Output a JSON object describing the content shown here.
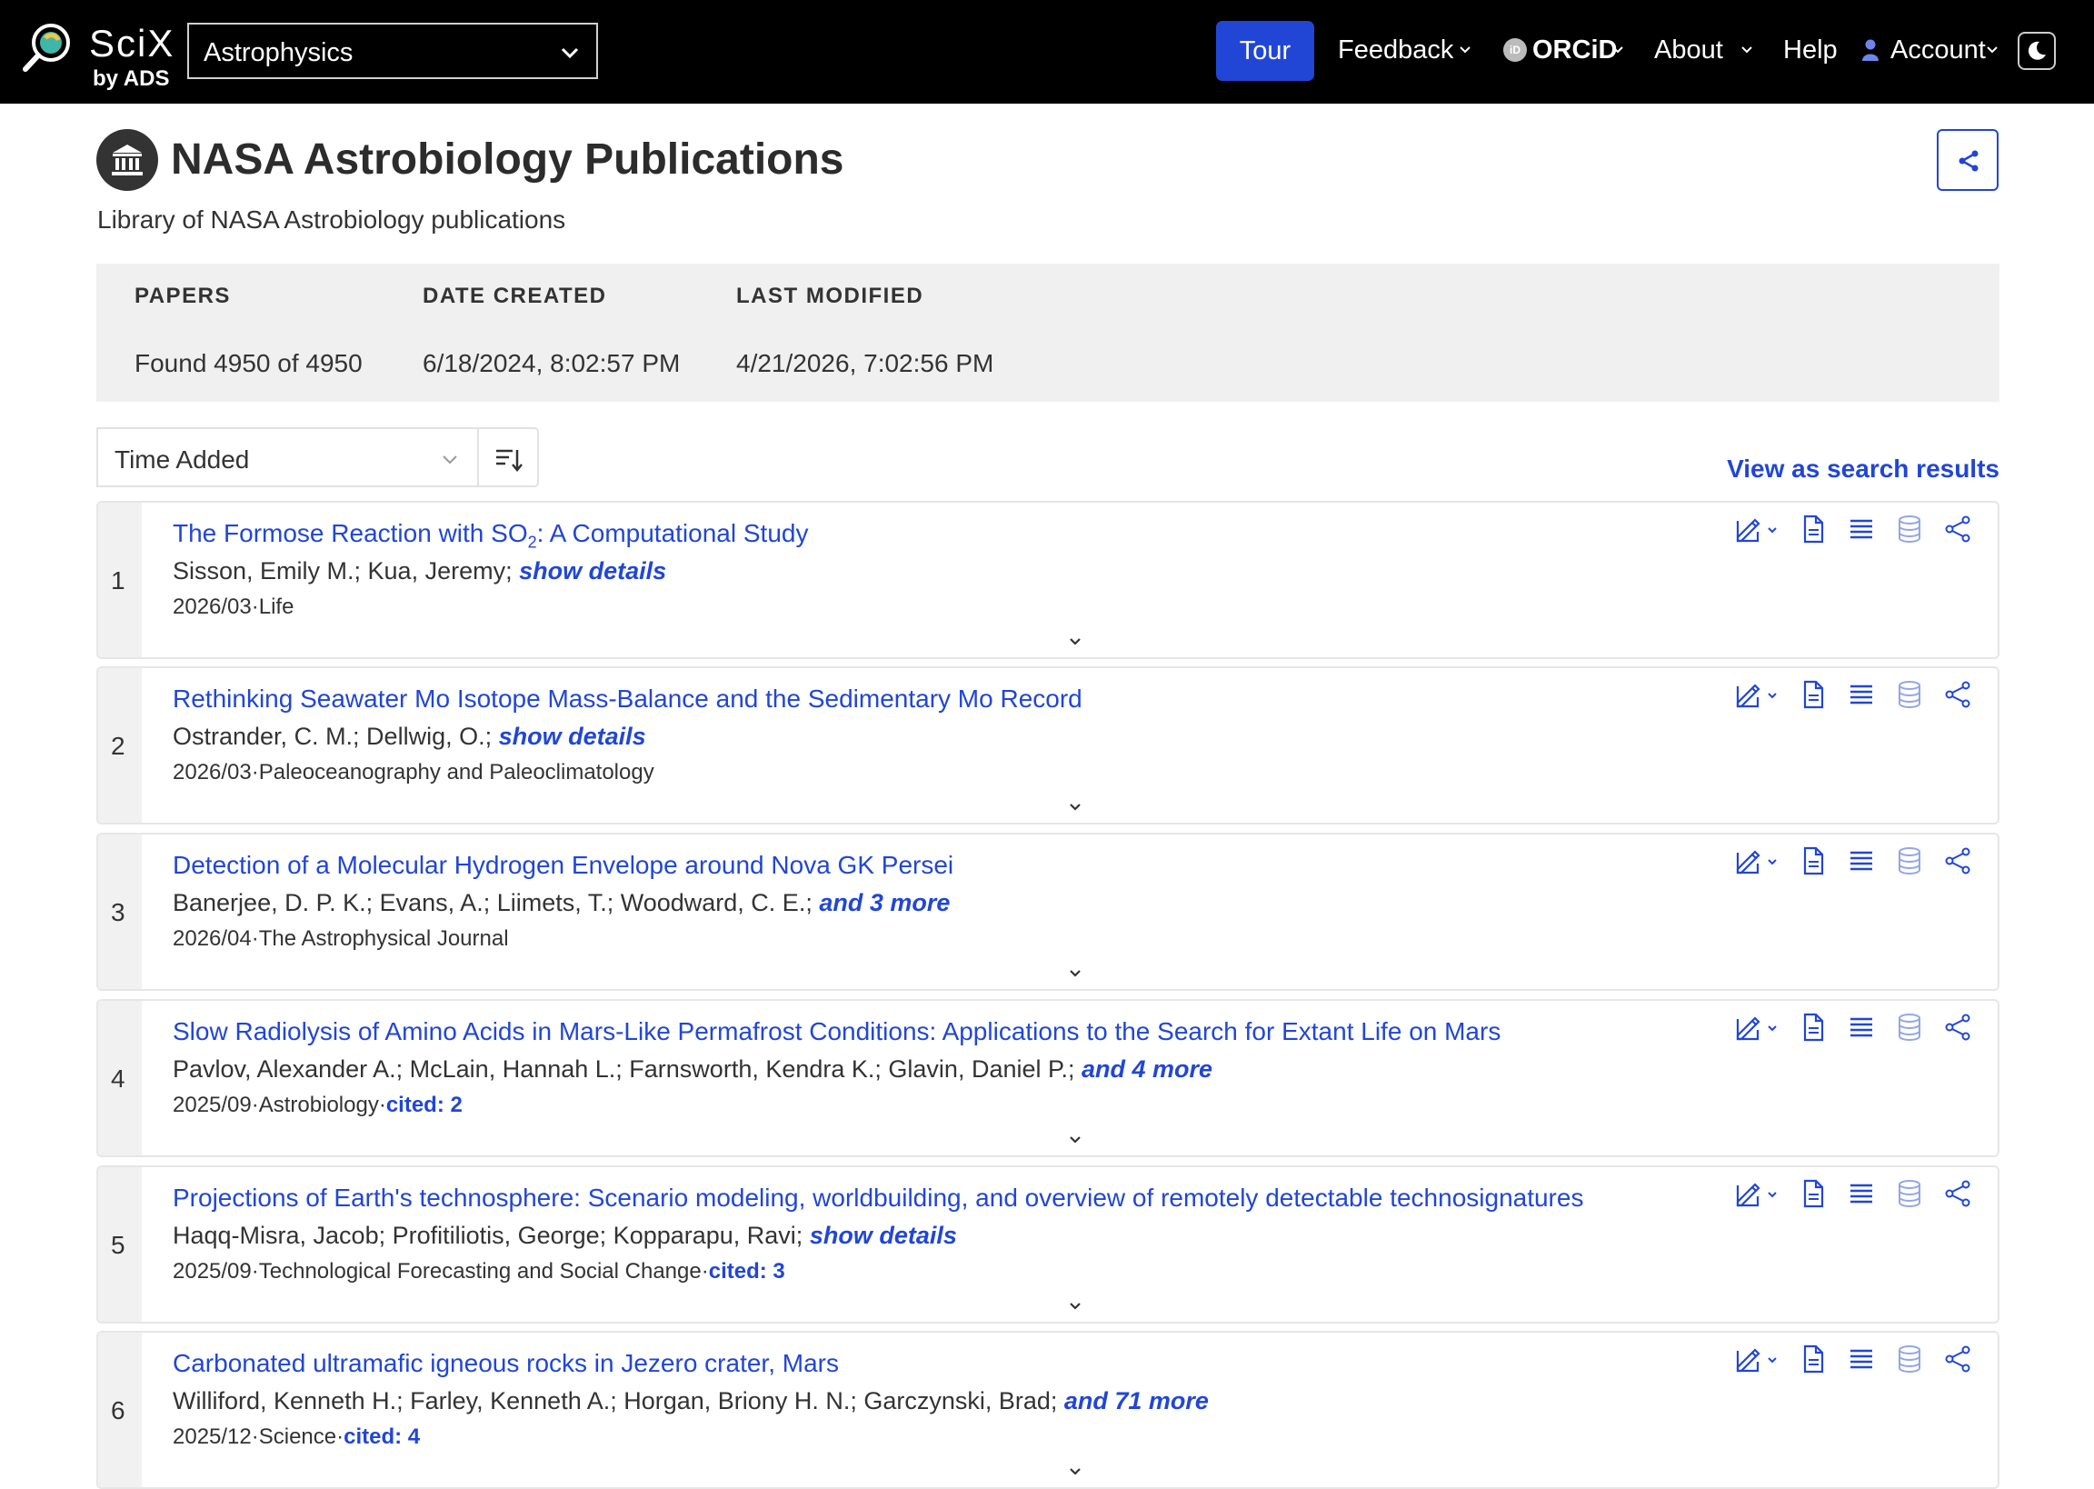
{
  "header": {
    "logo_text": "SciX",
    "logo_sub": "by ADS",
    "discipline": "Astrophysics",
    "nav": {
      "tour": "Tour",
      "feedback": "Feedback",
      "orcid": "ORCiD",
      "about": "About",
      "help": "Help",
      "account": "Account"
    },
    "colors": {
      "bar": "#000000",
      "tour_button": "#2146d6"
    }
  },
  "library": {
    "title": "NASA Astrobiology Publications",
    "description": "Library of NASA Astrobiology publications",
    "stats": {
      "papers_label": "PAPERS",
      "papers_value": "Found 4950 of 4950",
      "created_label": "DATE CREATED",
      "created_value": "6/18/2024, 8:02:57 PM",
      "modified_label": "LAST MODIFIED",
      "modified_value": "4/21/2026, 7:02:56 PM"
    }
  },
  "controls": {
    "sort_by": "Time Added",
    "view_as_search": "View as search results"
  },
  "results": [
    {
      "index": "1",
      "title_pre": "The Formose Reaction with SO",
      "title_sub": "2",
      "title_post": ": A Computational Study",
      "authors": "Sisson, Emily M.; Kua, Jeremy; ",
      "more": "show details",
      "meta": "2026/03·Life",
      "cited": ""
    },
    {
      "index": "2",
      "title_pre": "Rethinking Seawater Mo Isotope Mass-Balance and the Sedimentary Mo Record",
      "title_sub": "",
      "title_post": "",
      "authors": "Ostrander, C. M.; Dellwig, O.; ",
      "more": "show details",
      "meta": "2026/03·Paleoceanography and Paleoclimatology",
      "cited": ""
    },
    {
      "index": "3",
      "title_pre": "Detection of a Molecular Hydrogen Envelope around Nova GK Persei",
      "title_sub": "",
      "title_post": "",
      "authors": "Banerjee, D. P. K.; Evans, A.; Liimets, T.; Woodward, C. E.; ",
      "more": "and 3 more",
      "meta": "2026/04·The Astrophysical Journal",
      "cited": ""
    },
    {
      "index": "4",
      "title_pre": "Slow Radiolysis of Amino Acids in Mars-Like Permafrost Conditions: Applications to the Search for Extant Life on Mars",
      "title_sub": "",
      "title_post": "",
      "authors": "Pavlov, Alexander A.; McLain, Hannah L.; Farnsworth, Kendra K.; Glavin, Daniel P.; ",
      "more": "and 4 more",
      "meta": "2025/09·Astrobiology·",
      "cited": "cited: 2"
    },
    {
      "index": "5",
      "title_pre": "Projections of Earth's technosphere: Scenario modeling, worldbuilding, and overview of remotely detectable technosignatures",
      "title_sub": "",
      "title_post": "",
      "authors": "Haqq-Misra, Jacob; Profitiliotis, George; Kopparapu, Ravi; ",
      "more": "show details",
      "meta": "2025/09·Technological Forecasting and Social Change·",
      "cited": "cited: 3"
    },
    {
      "index": "6",
      "title_pre": "Carbonated ultramafic igneous rocks in Jezero crater, Mars",
      "title_sub": "",
      "title_post": "",
      "authors": "Williford, Kenneth H.; Farley, Kenneth A.; Horgan, Briony H. N.; Garczynski, Brad; ",
      "more": "and 71 more",
      "meta": "2025/12·Science·",
      "cited": "cited: 4"
    }
  ],
  "icons": {
    "logo": "scix-logo-icon",
    "discipline_chevron": "chevron-down-icon",
    "account": "user-icon",
    "theme": "moon-icon",
    "library": "institution-icon",
    "share": "share-icon",
    "sort_direction": "sort-descending-icon",
    "row_actions": [
      "edit-icon",
      "document-icon",
      "list-icon",
      "database-icon",
      "share-icon"
    ]
  },
  "accent_color": "#2146d6"
}
